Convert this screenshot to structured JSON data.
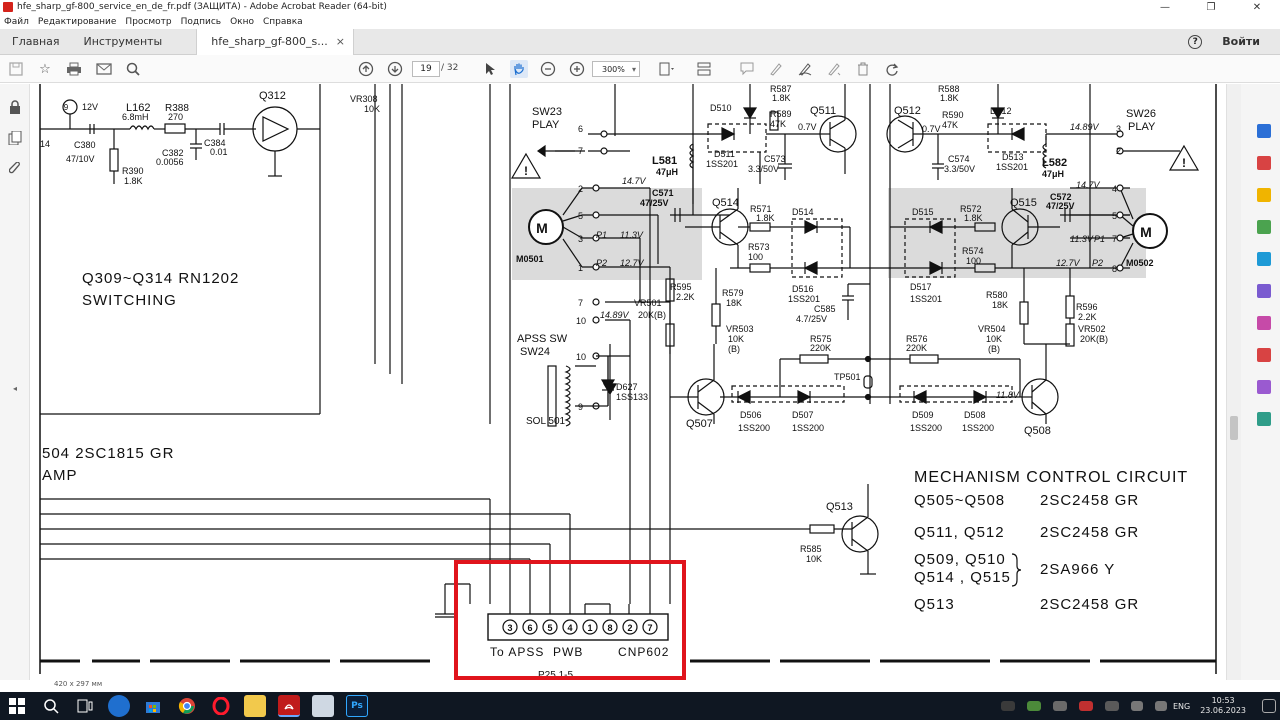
{
  "window": {
    "title": "hfe_sharp_gf-800_service_en_de_fr.pdf (ЗАЩИТА) - Adobe Acrobat Reader (64-bit)",
    "minimize": "—",
    "maximize": "❐",
    "close": "✕"
  },
  "menu": [
    "Файл",
    "Редактирование",
    "Просмотр",
    "Подпись",
    "Окно",
    "Справка"
  ],
  "tabs": {
    "home": "Главная",
    "tools": "Инструменты",
    "doc": "hfe_sharp_gf-800_s...",
    "close": "×",
    "help": "?",
    "login": "Войти"
  },
  "toolbar": {
    "page_current": "19",
    "page_total": "/ 32",
    "zoom": "300%"
  },
  "status": {
    "page_size": "420 x 297 мм"
  },
  "taskbar": {
    "lang": "ENG",
    "time": "10:53",
    "date": "23.06.2023"
  },
  "schematic": {
    "q_labels": [
      "Q312",
      "Q511",
      "Q512",
      "Q514",
      "Q515",
      "Q507",
      "Q508",
      "Q513"
    ],
    "left_text": [
      "Q309~Q314  RN1202",
      "SWITCHING",
      "504  2SC1815  GR",
      "AMP"
    ],
    "switches": [
      "SW23",
      "PLAY",
      "SW26",
      "PLAY",
      "APSS SW",
      "SW24"
    ],
    "motors": [
      "M0501",
      "M0502"
    ],
    "parts": {
      "l162": "L162",
      "l162v": "6.8mH",
      "r388": "R388",
      "r388v": "270",
      "c380": "C380",
      "c380v": "47/10V",
      "c382": "C382",
      "c382v": "0.0056",
      "c384": "C384",
      "c384v": "0.01",
      "r390": "R390",
      "r390v": "1.8K",
      "vr308": "VR308",
      "vr308v": "10K",
      "v12": "12V",
      "n9": "9",
      "n14": "14",
      "r587": "R587",
      "r587v": "1.8K",
      "r588": "R588",
      "r588v": "1.8K",
      "d510": "D510",
      "d511": "D511",
      "d511v": "1SS201",
      "r589": "R589",
      "r589v": "47K",
      "v07a": "0.7V",
      "v07b": "0.7V",
      "r590": "R590",
      "r590v": "47K",
      "d512": "D512",
      "d513": "D513",
      "d513v": "1SS201",
      "c573": "C573",
      "c573v": "3.3/50V",
      "c574": "C574",
      "c574v": "3.3/50V",
      "l581": "L581",
      "l581v": "47μH",
      "l582": "L582",
      "l582v": "47μH",
      "v147a": "14.7V",
      "v147b": "14.7V",
      "v1489a": "14.89V",
      "c571": "C571",
      "c571v": "47/25V",
      "c572": "C572",
      "c572v": "47/25V",
      "r571": "R571",
      "r571v": "1.8K",
      "d514": "D514",
      "d515": "D515",
      "r572": "R572",
      "r572v": "1.8K",
      "p1a": "P1",
      "v113a": "11.3V",
      "p1b": "P1",
      "v113b": "11.3V",
      "r573": "R573",
      "r573v": "100",
      "r574": "R574",
      "r574v": "100",
      "p2a": "P2",
      "v127a": "12.7V",
      "p2b": "P2",
      "v127b": "12.7V",
      "d516": "D516",
      "d516v": "1SS201",
      "d517": "D517",
      "d517v": "1SS201",
      "c585": "C585",
      "c585v": "4.7/25V",
      "vr501": "VR501",
      "r595": "R595",
      "r595v": "2.2K",
      "r579": "R579",
      "r579v": "18K",
      "r580": "R580",
      "r580v": "18K",
      "r596": "R596",
      "r596v": "2.2K",
      "v1489b": "14.89V",
      "k20b": "20K(B)",
      "vr503": "VR503",
      "vr503v": "10K",
      "vr503b": "(B)",
      "vr504": "VR504",
      "vr504v": "10K",
      "vr504b": "(B)",
      "vr502": "VR502",
      "vr502v": "20K(B)",
      "r575": "R575",
      "r575v": "220K",
      "r576": "R576",
      "r576v": "220K",
      "d627": "D627",
      "d627v": "1SS133",
      "tp501": "TP501",
      "v118": "11.8V",
      "d506": "D506",
      "d506v": "1SS200",
      "d507": "D507",
      "d507v": "1SS200",
      "d509": "D509",
      "d509v": "1SS200",
      "d508": "D508",
      "d508v": "1SS200",
      "sol": "SOL 501",
      "r585": "R585",
      "r585v": "10K"
    },
    "pins": {
      "p6": "6",
      "p7": "7",
      "p2": "2",
      "p5": "5",
      "p3": "3",
      "p1": "1",
      "p10": "10",
      "p9": "9",
      "p3r": "3",
      "p2r": "2",
      "p4r": "4",
      "p5r": "5",
      "p7r": "7",
      "p8r": "8"
    },
    "connector_pins": [
      "3",
      "6",
      "5",
      "4",
      "1",
      "8",
      "2",
      "7"
    ],
    "connector_caption": "To APSS  PWB        CNP602",
    "page_ref": "P25  1-5",
    "mech_title": "MECHANISM  CONTROL  CIRCUIT",
    "mech_rows": [
      {
        "left": "Q505~Q508",
        "right": "2SC2458   GR"
      },
      {
        "left": "Q511, Q512",
        "right": "2SC2458   GR"
      },
      {
        "left": "Q509, Q510",
        "right": ""
      },
      {
        "left": "Q514 , Q515",
        "right": "2SA966  Y"
      },
      {
        "left": "Q513",
        "right": "2SC2458   GR"
      }
    ]
  },
  "colors": {
    "highlight_box": "#e0141c",
    "taskbar": "#0f1722",
    "acrobat_red": "#d4231b"
  }
}
